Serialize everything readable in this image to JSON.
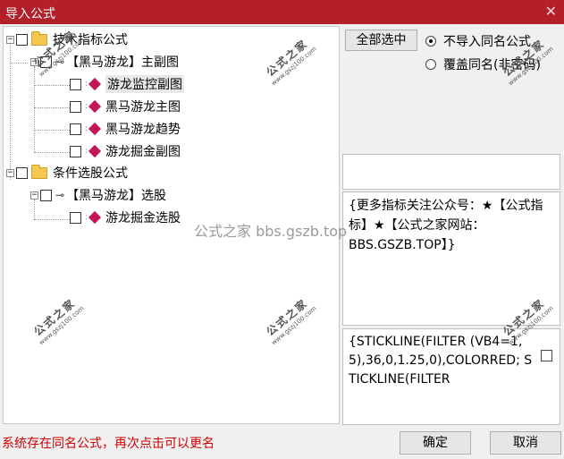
{
  "window": {
    "title": "导入公式",
    "close_glyph": "✕",
    "accent_color": "#b3202a"
  },
  "tree": {
    "group1": {
      "expander": "−",
      "label": "技术指标公式",
      "child": {
        "expander": "−",
        "label": "【黑马游龙】主副图",
        "items": [
          "游龙监控副图",
          "黑马游龙主图",
          "黑马游龙趋势",
          "游龙掘金副图"
        ]
      }
    },
    "group2": {
      "expander": "−",
      "label": "条件选股公式",
      "child": {
        "expander": "−",
        "label": "【黑马游龙】选股",
        "items": [
          "游龙掘金选股"
        ]
      }
    }
  },
  "options": {
    "select_all_label": "全部选中",
    "radio_skip_label": "不导入同名公式",
    "radio_overwrite_label": "覆盖同名(非密码)",
    "selected": "skip"
  },
  "info_text": "{更多指标关注公众号：★【公式指标】★【公式之家网站：BBS.GSZB.TOP】}",
  "code_text": "{STICKLINE(FILTER (VB4=1,5),36,0,1.25,0),COLORRED; STICKLINE(FILTER",
  "status_text": "系统存在同名公式，再次点击可以更名",
  "buttons": {
    "ok": "确定",
    "cancel": "取消"
  },
  "watermark": {
    "center_text": "公式之家 bbs.gszb.top",
    "stamp_big": "公式之家",
    "stamp_small": "www.gszj100.com"
  },
  "icons": {
    "folder": "folder-icon",
    "key": "key-icon",
    "formula": "formula-gem-icon"
  }
}
